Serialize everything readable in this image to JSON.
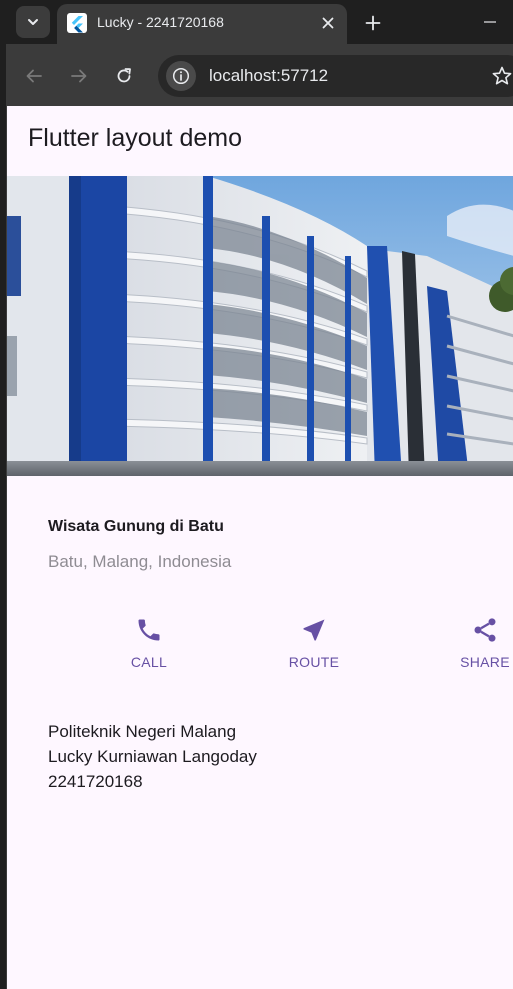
{
  "browser": {
    "tab_title": "Lucky - 2241720168",
    "url": "localhost:57712"
  },
  "app": {
    "appbar_title": "Flutter layout demo",
    "title_section": {
      "name": "Wisata Gunung di Batu",
      "location": "Batu, Malang, Indonesia"
    },
    "actions": [
      {
        "label": "CALL",
        "icon": "phone-icon"
      },
      {
        "label": "ROUTE",
        "icon": "navigation-arrow-icon"
      },
      {
        "label": "SHARE",
        "icon": "share-icon"
      }
    ],
    "text_lines": [
      "Politeknik Negeri Malang",
      "Lucky Kurniawan Langoday",
      "2241720168"
    ],
    "colors": {
      "accent": "#6750a4",
      "background": "#fef7ff",
      "text": "#1d1b20",
      "secondary_text": "#8f8c93"
    }
  }
}
